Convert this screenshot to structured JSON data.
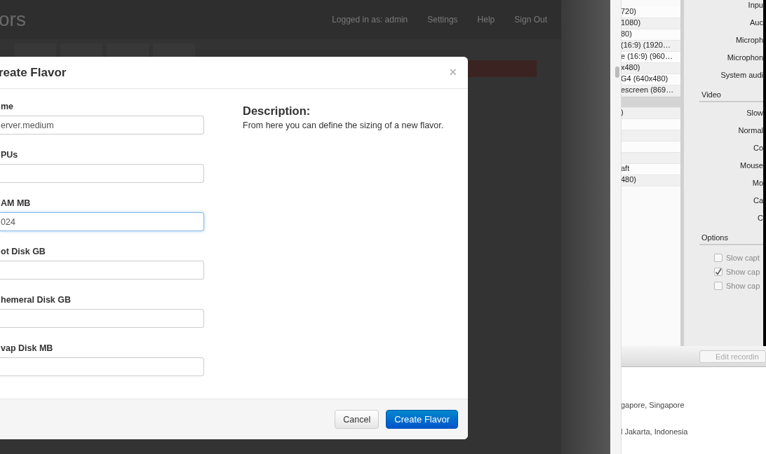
{
  "page": {
    "title": "ors",
    "header_links": [
      "Logged in as: admin",
      "Settings",
      "Help",
      "Sign Out"
    ]
  },
  "modal": {
    "title": "reate Flavor",
    "close": "×",
    "fields": [
      {
        "label": "me",
        "value": "erver.medium",
        "focused": false
      },
      {
        "label": "PUs",
        "focused": false
      },
      {
        "label": "AM MB",
        "value": "024",
        "focused": true
      },
      {
        "label": "ot Disk GB",
        "focused": false
      },
      {
        "label": "hemeral Disk GB",
        "focused": false
      },
      {
        "label": "vap Disk MB",
        "focused": false
      }
    ],
    "description": {
      "heading": "Description:",
      "text": "From here you can define the sizing of a new flavor."
    },
    "buttons": [
      {
        "label": "Cancel",
        "kind": "default"
      },
      {
        "label": "Create Flavor",
        "kind": "primary"
      }
    ]
  },
  "recorder": {
    "presets": [
      {
        "label": "720)",
        "selected": false
      },
      {
        "label": "1080)",
        "selected": false
      },
      {
        "label": "80)",
        "selected": false
      },
      {
        "label": "(16:9) (1920…",
        "selected": false
      },
      {
        "label": "e (16:9) (960…",
        "selected": false
      },
      {
        "label": "x480)",
        "selected": false
      },
      {
        "label": "G4 (640x480)",
        "selected": false
      },
      {
        "label": "escreen (869…",
        "selected": false
      },
      {
        "selected": true
      },
      {
        "label": ")",
        "selected": false
      },
      {
        "selected": false
      },
      {
        "selected": false
      },
      {
        "selected": false
      },
      {
        "selected": false
      },
      {
        "label": "aft",
        "selected": false
      },
      {
        "label": "480)",
        "selected": false
      }
    ],
    "settings": [
      {
        "kind": "label",
        "text": "Inpu"
      },
      {
        "kind": "label",
        "text": "Auc"
      },
      {
        "kind": "label",
        "text": "Microph"
      },
      {
        "kind": "label",
        "text": "Microphon"
      },
      {
        "kind": "label",
        "text": "System audi"
      },
      {
        "kind": "section",
        "text": "Video"
      },
      {
        "kind": "label",
        "text": "Slow"
      },
      {
        "kind": "label",
        "text": "Normal"
      },
      {
        "kind": "label",
        "text": "Co"
      },
      {
        "kind": "label",
        "text": "Mouse"
      },
      {
        "kind": "label",
        "text": "Mo"
      },
      {
        "kind": "label",
        "text": "Ca"
      },
      {
        "kind": "label",
        "text": "C"
      },
      {
        "kind": "section",
        "text": "Options"
      },
      {
        "kind": "checkbox",
        "text": "Slow capt",
        "checked": false
      },
      {
        "kind": "checkbox",
        "text": "Show cap",
        "checked": true
      },
      {
        "kind": "checkbox",
        "text": "Show cap",
        "checked": false
      }
    ],
    "edit_button": "Edit recordin",
    "locations": [
      "gapore, Singapore",
      "l Jakarta, Indonesia"
    ]
  }
}
